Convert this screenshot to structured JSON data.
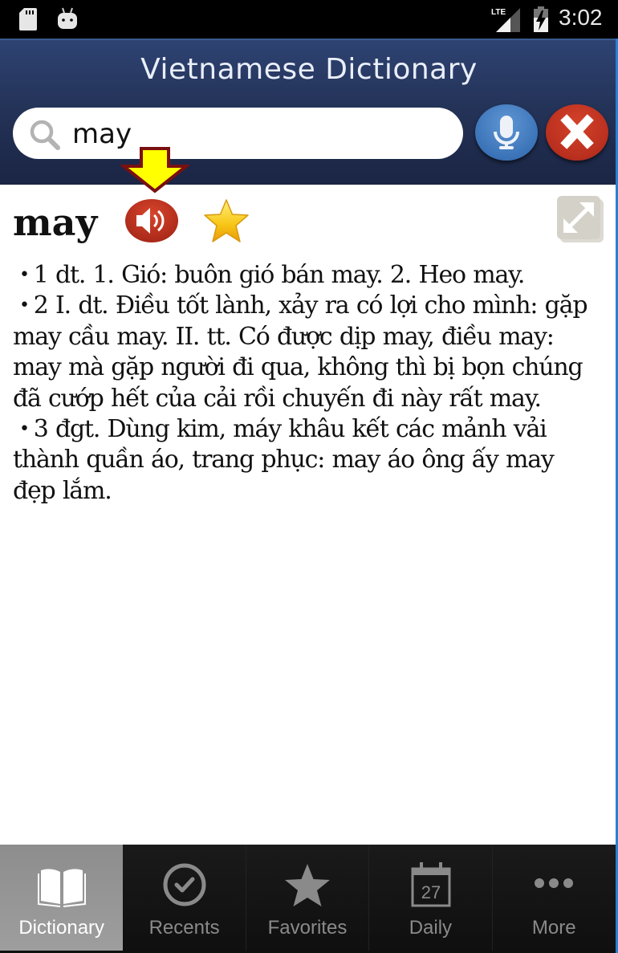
{
  "status_bar": {
    "time": "3:02",
    "network": "LTE",
    "icons": [
      "sd-card-icon",
      "android-debug-icon",
      "lte-signal-icon",
      "battery-charging-icon"
    ]
  },
  "header": {
    "title": "Vietnamese Dictionary",
    "search": {
      "value": "may",
      "placeholder": ""
    },
    "mic_button_icon": "microphone-icon",
    "clear_button_icon": "close-icon"
  },
  "entry": {
    "headword": "may",
    "actions": [
      "speaker-icon",
      "star-icon",
      "expand-icon"
    ],
    "definitions": [
      {
        "bullet": "•",
        "text": "1 dt. 1. Gió: buôn gió bán may. 2. Heo may."
      },
      {
        "bullet": "•",
        "text": "2 I. dt. Điều tốt lành, xảy ra có lợi cho mình: gặp may cầu may. II. tt. Có được dịp may, điều may: may mà gặp người đi qua, không thì bị bọn chúng đã cướp hết của cải rồi chuyến đi này rất may."
      },
      {
        "bullet": "•",
        "text": "3 đgt. Dùng kim, máy khâu kết các mảnh vải thành quần áo, trang phục: may áo ông ấy may đẹp lắm."
      }
    ],
    "annotation": "pointer-arrow-to-speaker"
  },
  "tabs": [
    {
      "label": "Dictionary",
      "icon": "book-icon",
      "active": true
    },
    {
      "label": "Recents",
      "icon": "check-circle-icon",
      "active": false
    },
    {
      "label": "Favorites",
      "icon": "star-icon",
      "active": false
    },
    {
      "label": "Daily",
      "icon": "calendar-icon",
      "day": "27",
      "active": false
    },
    {
      "label": "More",
      "icon": "more-dots-icon",
      "active": false
    }
  ],
  "colors": {
    "header": "#243358",
    "accent_blue": "#3b73b8",
    "accent_red": "#b92f1e",
    "star": "#f5c400",
    "arrow_fill": "#ffff00",
    "arrow_outline": "#7a1010",
    "tab_active": "#959595"
  }
}
